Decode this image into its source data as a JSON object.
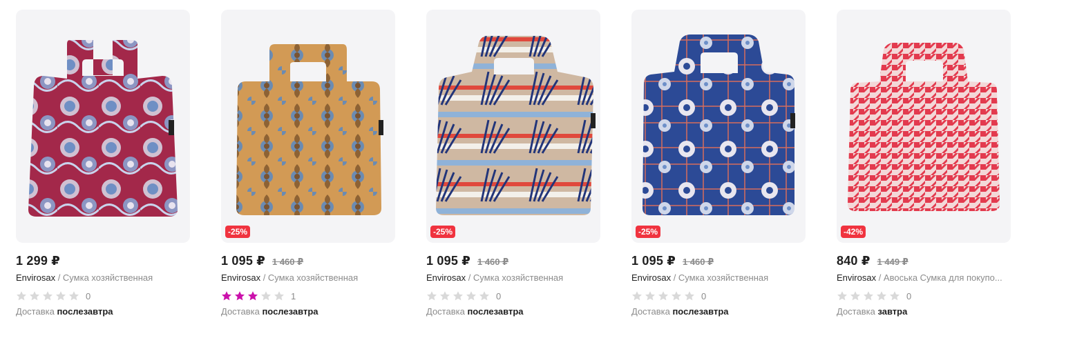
{
  "colors": {
    "badge": "#f0333f",
    "star_filled": "#cb11ab",
    "star_empty": "#d9d9d9"
  },
  "products": [
    {
      "price": "1 299 ₽",
      "old_price": "",
      "discount": "",
      "brand": "Envirosax",
      "separator": " / ",
      "name": "Сумка хозяйственная",
      "rating_stars": 0,
      "review_count": "0",
      "delivery_label": "Доставка",
      "delivery_day": "послезавтра",
      "image": "bag-red-peacock-pattern"
    },
    {
      "price": "1 095 ₽",
      "old_price": "1 460 ₽",
      "discount": "-25%",
      "brand": "Envirosax",
      "separator": " / ",
      "name": "Сумка хозяйственная",
      "rating_stars": 3,
      "review_count": "1",
      "delivery_label": "Доставка",
      "delivery_day": "послезавтра",
      "image": "bag-orange-damask-pattern"
    },
    {
      "price": "1 095 ₽",
      "old_price": "1 460 ₽",
      "discount": "-25%",
      "brand": "Envirosax",
      "separator": " / ",
      "name": "Сумка хозяйственная",
      "rating_stars": 0,
      "review_count": "0",
      "delivery_label": "Доставка",
      "delivery_day": "послезавтра",
      "image": "bag-shell-stripe-pattern"
    },
    {
      "price": "1 095 ₽",
      "old_price": "1 460 ₽",
      "discount": "-25%",
      "brand": "Envirosax",
      "separator": " / ",
      "name": "Сумка хозяйственная",
      "rating_stars": 0,
      "review_count": "0",
      "delivery_label": "Доставка",
      "delivery_day": "послезавтра",
      "image": "bag-blue-floral-plaid-pattern"
    },
    {
      "price": "840 ₽",
      "old_price": "1 449 ₽",
      "discount": "-42%",
      "brand": "Envirosax",
      "separator": " / ",
      "name": "Авоська Сумка для покупо...",
      "rating_stars": 0,
      "review_count": "0",
      "delivery_label": "Доставка",
      "delivery_day": "завтра",
      "image": "bag-red-houndstooth-pattern"
    }
  ]
}
